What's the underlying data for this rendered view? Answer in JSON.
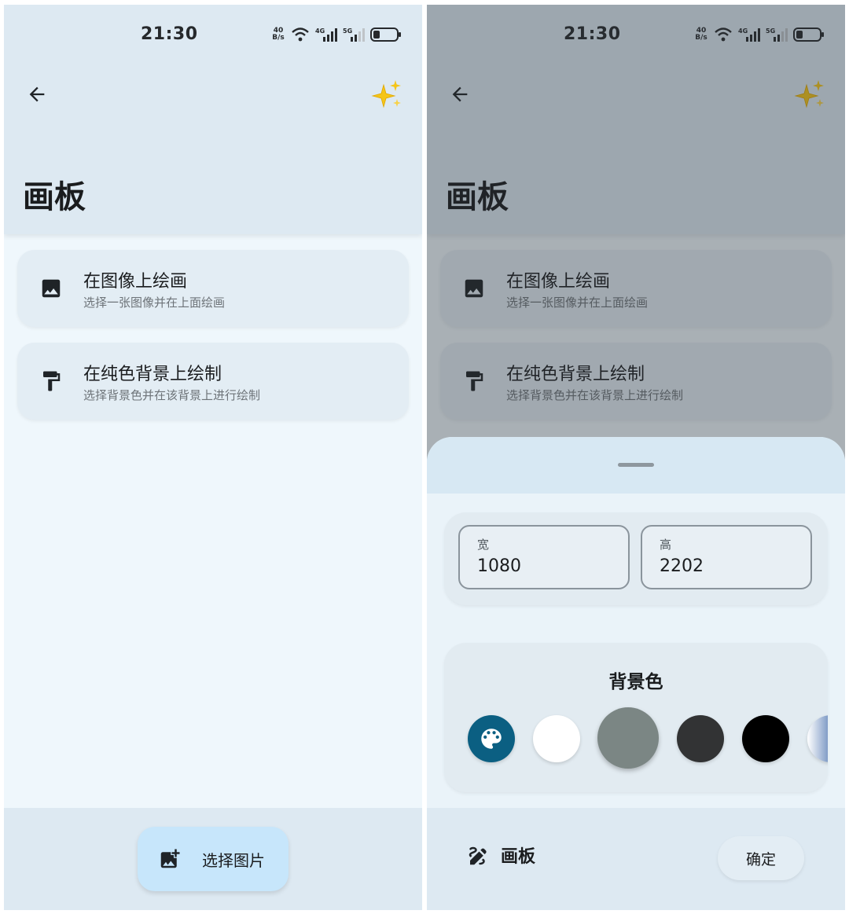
{
  "status_bar": {
    "time": "21:30",
    "net_speed_value": "40",
    "net_speed_unit": "B/s",
    "signal_1": "4G",
    "signal_2": "5G"
  },
  "app_bar": {
    "title": "画板",
    "back_icon": "arrow-left-icon",
    "action_icon": "sparkles-icon"
  },
  "options": [
    {
      "title": "在图像上绘画",
      "subtitle": "选择一张图像并在上面绘画",
      "icon": "image-icon"
    },
    {
      "title": "在纯色背景上绘制",
      "subtitle": "选择背景色并在该背景上进行绘制",
      "icon": "paint-roller-icon"
    }
  ],
  "fab": {
    "label": "选择图片",
    "icon": "add-photo-icon"
  },
  "sheet": {
    "width_label": "宽",
    "width_value": "1080",
    "height_label": "高",
    "height_value": "2202",
    "background_title": "背景色",
    "swatches": [
      {
        "name": "picker",
        "color": "#0b5f82",
        "icon": "palette-icon"
      },
      {
        "name": "white",
        "color": "#ffffff"
      },
      {
        "name": "gray",
        "color": "#7b8684",
        "selected": true
      },
      {
        "name": "dark-gray",
        "color": "#323334"
      },
      {
        "name": "black",
        "color": "#000000"
      },
      {
        "name": "blue",
        "color": "#5f82b8"
      }
    ],
    "footer_title": "画板",
    "footer_icon": "draw-icon",
    "confirm_label": "确定"
  },
  "colors": {
    "accent": "#0b5f82",
    "surface": "#eff7fc",
    "app_bar": "#dde9f2",
    "fab": "#c7e6fb"
  }
}
